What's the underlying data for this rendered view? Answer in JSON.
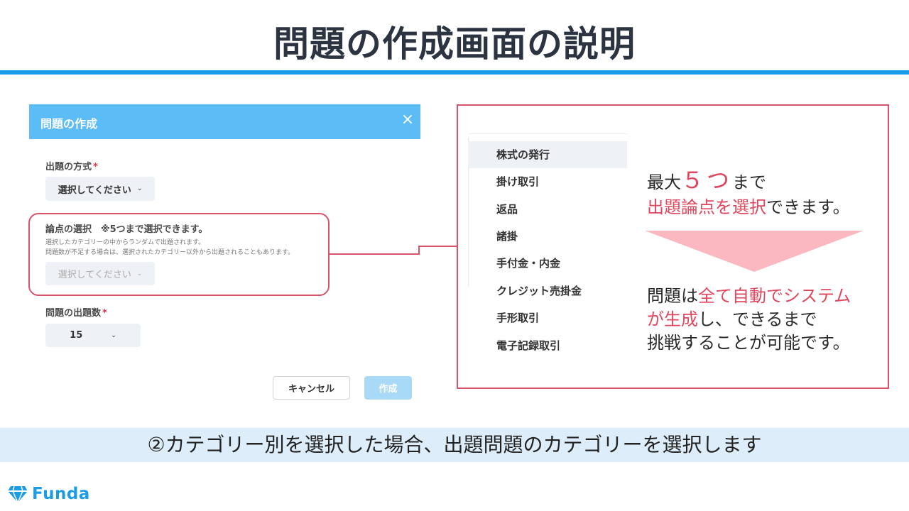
{
  "page": {
    "title": "問題の作成画面の説明"
  },
  "dialog": {
    "title": "問題の作成",
    "close_label": "×",
    "method": {
      "label": "出題の方式",
      "required_mark": "*",
      "selected": "選択してください"
    },
    "topic": {
      "label": "論点の選択　※5つまで選択できます。",
      "note_1": "選択したカテゴリーの中からランダムで出題されます。",
      "note_2": "問題数が不足する場合は、選択されたカテゴリー以外から出題されることもあります。",
      "selected": "選択してください"
    },
    "count": {
      "label": "問題の出題数",
      "required_mark": "*",
      "selected": "15"
    },
    "cancel_label": "キャンセル",
    "create_label": "作成"
  },
  "options": [
    "株式の発行",
    "掛け取引",
    "返品",
    "諸掛",
    "手付金・内金",
    "クレジット売掛金",
    "手形取引",
    "電子記録取引"
  ],
  "callout": {
    "line1_a": "最大",
    "line1_num": "５つ",
    "line1_b": "まで",
    "line2_pink": "出題論点を選択",
    "line2_rest": "できます。",
    "line3_a": "問題は",
    "line3_pink": "全て自動でシステム",
    "line4_pink": "が生成",
    "line4_rest": "し、できるまで",
    "line5": "挑戦することが可能です。"
  },
  "caption": "②カテゴリー別を選択した場合、出題問題のカテゴリーを選択します",
  "logo": {
    "text": "Funda"
  },
  "colors": {
    "accent_blue": "#1a9ce6",
    "dialog_header": "#5cbdf6",
    "highlight_pink": "#e0475f",
    "frame_red": "#d9536a",
    "arrow_pink": "#fbb8c1"
  }
}
